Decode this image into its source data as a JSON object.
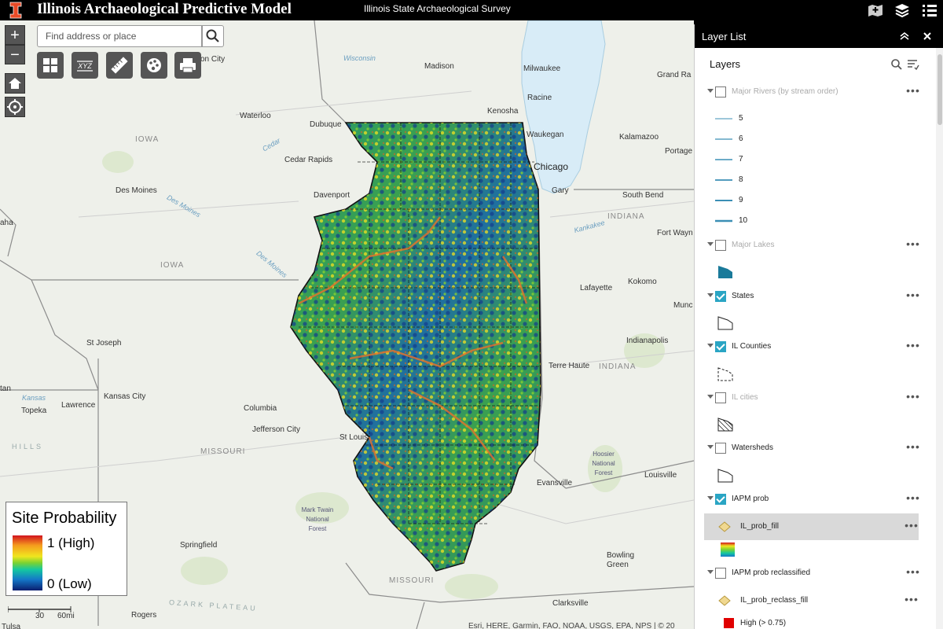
{
  "header": {
    "title": "Illinois Archaeological Predictive Model",
    "subtitle": "Illinois State Archaeological Survey"
  },
  "search": {
    "placeholder": "Find address or place"
  },
  "zoom": {
    "in_label": "+",
    "out_label": "−"
  },
  "map_labels": {
    "states": [
      "IOWA",
      "IOWA",
      "MISSOURI",
      "MISSOURI",
      "INDIANA",
      "INDIANA"
    ],
    "cities": [
      "Madison",
      "Milwaukee",
      "Grand Ra",
      "Racine",
      "Kenosha",
      "Waukegan",
      "Chicago",
      "Kalamazoo",
      "Portage",
      "Gary",
      "South Bend",
      "Waterloo",
      "Dubuque",
      "Cedar Rapids",
      "Davenport",
      "Des Moines",
      "Fort Wayn",
      "Kokomo",
      "Lafayette",
      "Munc",
      "Indianapolis",
      "Terre Haute",
      "St Joseph",
      "Kansas City",
      "Lawrence",
      "Topeka",
      "Columbia",
      "Jefferson City",
      "St Louis",
      "Evansville",
      "Louisville",
      "Springfield",
      "Bowling Green",
      "Clarksville",
      "Rogers",
      "Tulsa",
      "on City",
      "tan",
      "aha"
    ],
    "water": [
      "Wisconsin",
      "Cedar",
      "Des Moines",
      "Des Moines",
      "Kankakee",
      "Kansas"
    ],
    "parks": [
      "Mark Twain National Forest",
      "Hoosier National Forest"
    ],
    "regions": [
      "HILLS",
      "OZARK PLATEAU"
    ]
  },
  "legend": {
    "title": "Site Probability",
    "high": "1 (High)",
    "low": "0 (Low)"
  },
  "scalebar": {
    "km": "30",
    "mi": "60mi"
  },
  "attribution": "Esri, HERE, Garmin, FAO, NOAA, USGS, EPA, NPS | © 20",
  "panel": {
    "title": "Layer List",
    "subtitle": "Layers",
    "layers": [
      {
        "name": "Major Rivers (by stream order)",
        "checked": false
      },
      {
        "name": "Major Lakes",
        "checked": false
      },
      {
        "name": "States",
        "checked": true
      },
      {
        "name": "IL Counties",
        "checked": true
      },
      {
        "name": "IL cities",
        "checked": false
      },
      {
        "name": "Watersheds",
        "checked": false
      },
      {
        "name": "IAPM prob",
        "checked": true
      },
      {
        "name": "IAPM prob reclassified",
        "checked": false
      }
    ],
    "river_orders": [
      "5",
      "6",
      "7",
      "8",
      "9",
      "10"
    ],
    "sublayers": {
      "prob_fill": "IL_prob_fill",
      "reclass_fill": "IL_prob_reclass_fill",
      "reclass_high": "High (> 0.75)"
    }
  },
  "colors": {
    "accent": "#2aa5c4",
    "river_symbol": "#3b8fb5",
    "lake_symbol": "#1a7a9a",
    "reclass_high": "#e00000"
  }
}
